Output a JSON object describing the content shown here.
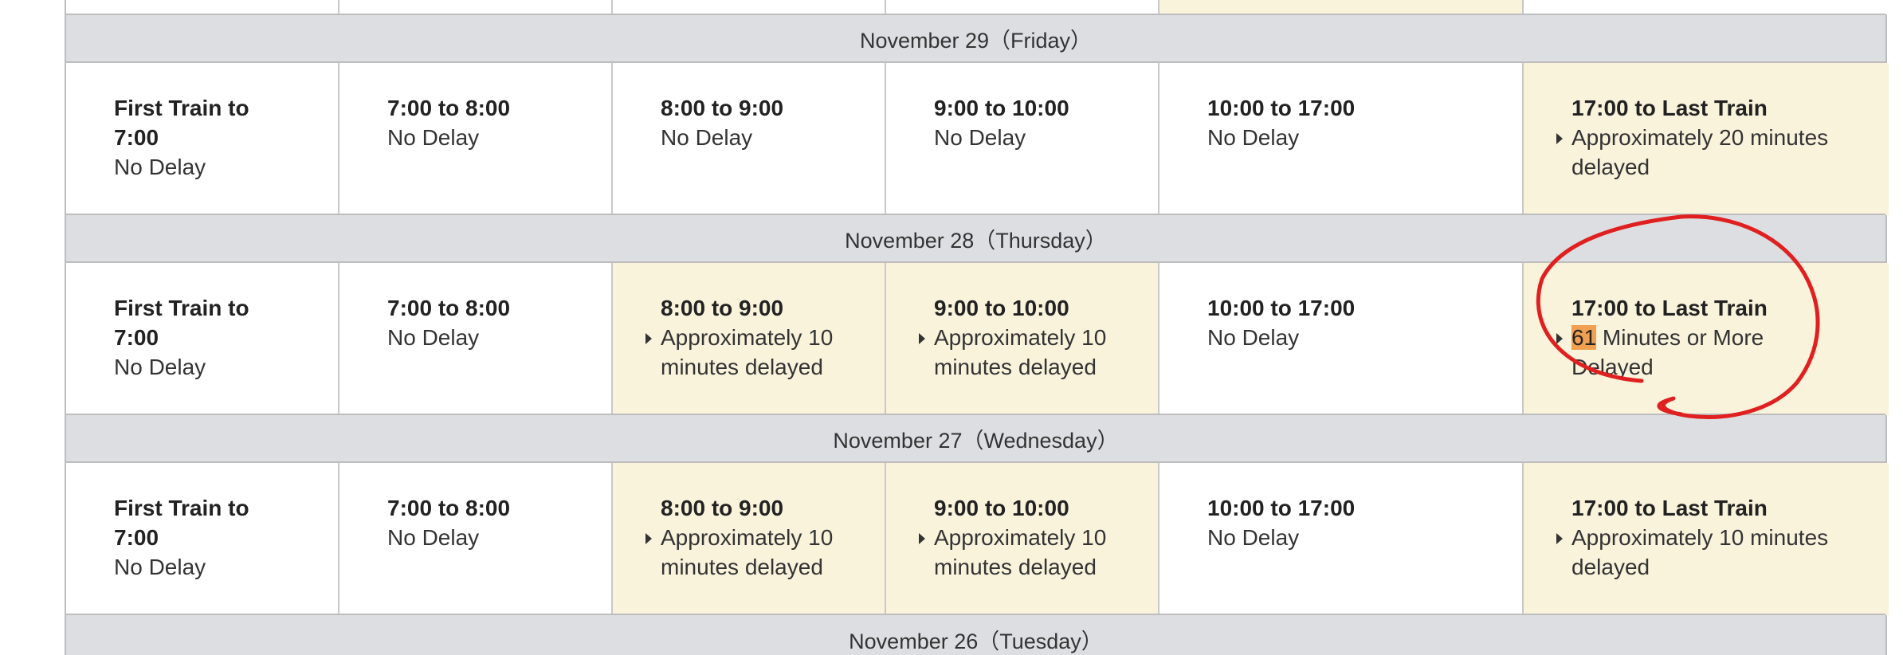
{
  "colors": {
    "date_row_bg": "#dcdee1",
    "delayed_cell_bg": "#f9f3dc",
    "highlight": "#f0a050",
    "annotation": "#e02020"
  },
  "days": [
    {
      "date_label": "November 29（Friday）",
      "slots": [
        {
          "time": "First Train to 7:00",
          "status": "No Delay",
          "delayed": false
        },
        {
          "time": "7:00 to 8:00",
          "status": "No Delay",
          "delayed": false
        },
        {
          "time": "8:00 to 9:00",
          "status": "No Delay",
          "delayed": false
        },
        {
          "time": "9:00 to 10:00",
          "status": "No Delay",
          "delayed": false
        },
        {
          "time": "10:00 to 17:00",
          "status": "No Delay",
          "delayed": false
        },
        {
          "time": "17:00 to Last Train",
          "status": "Approximately 20 minutes delayed",
          "delayed": true
        }
      ]
    },
    {
      "date_label": "November 28（Thursday）",
      "slots": [
        {
          "time": "First Train to 7:00",
          "status": "No Delay",
          "delayed": false
        },
        {
          "time": "7:00 to 8:00",
          "status": "No Delay",
          "delayed": false
        },
        {
          "time": "8:00 to 9:00",
          "status": "Approximately 10 minutes delayed",
          "delayed": true
        },
        {
          "time": "9:00 to 10:00",
          "status": "Approximately 10 minutes delayed",
          "delayed": true
        },
        {
          "time": "10:00 to 17:00",
          "status": "No Delay",
          "delayed": false
        },
        {
          "time": "17:00 to Last Train",
          "status_highlight": "61",
          "status": " Minutes or More Delayed",
          "delayed": true
        }
      ]
    },
    {
      "date_label": "November 27（Wednesday）",
      "slots": [
        {
          "time": "First Train to 7:00",
          "status": "No Delay",
          "delayed": false
        },
        {
          "time": "7:00 to 8:00",
          "status": "No Delay",
          "delayed": false
        },
        {
          "time": "8:00 to 9:00",
          "status": "Approximately 10 minutes delayed",
          "delayed": true
        },
        {
          "time": "9:00 to 10:00",
          "status": "Approximately 10 minutes delayed",
          "delayed": true
        },
        {
          "time": "10:00 to 17:00",
          "status": "No Delay",
          "delayed": false
        },
        {
          "time": "17:00 to Last Train",
          "status": "Approximately 10 minutes delayed",
          "delayed": true
        }
      ]
    },
    {
      "date_label": "November 26（Tuesday）"
    }
  ]
}
